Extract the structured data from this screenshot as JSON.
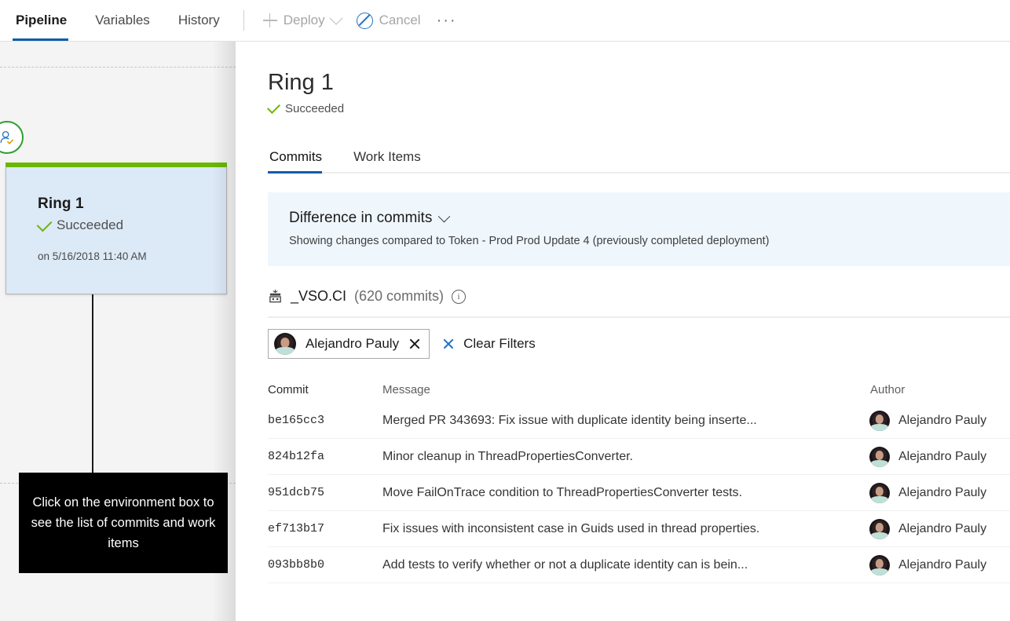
{
  "toolbar": {
    "tabs": [
      {
        "label": "Pipeline",
        "active": true
      },
      {
        "label": "Variables",
        "active": false
      },
      {
        "label": "History",
        "active": false
      }
    ],
    "deploy_label": "Deploy",
    "cancel_label": "Cancel",
    "more_label": "···",
    "deploy_icon": "plus-icon",
    "deploy_chevron_icon": "chevron-down-icon",
    "cancel_icon": "circle-slash-icon",
    "more_icon": "ellipsis-icon",
    "accent_color": "#0b5cab",
    "disabled_color": "#a6a6a6"
  },
  "pipeline": {
    "environment_card": {
      "name": "Ring 1",
      "status": "Succeeded",
      "timestamp": "on 5/16/2018 11:40 AM",
      "status_icon": "check-icon",
      "badge_icon": "approval-person-check-icon",
      "top_bar_color": "#6bb700",
      "background_color": "#dce9f7",
      "status_color": "#6bb700"
    },
    "callout": {
      "text": "Click on the environment box to see the list of commits and work items",
      "background_color": "#000000",
      "text_color": "#ffffff"
    }
  },
  "detail": {
    "title": "Ring 1",
    "status": "Succeeded",
    "status_icon": "check-icon",
    "tabs": [
      {
        "label": "Commits",
        "active": true
      },
      {
        "label": "Work Items",
        "active": false
      }
    ],
    "banner": {
      "heading": "Difference in commits",
      "chevron_icon": "chevron-down-icon",
      "subtext": "Showing changes compared to Token - Prod Prod Update 4 (previously completed deployment)",
      "background_color": "#eff6fc"
    },
    "repo": {
      "icon": "build-definition-icon",
      "name": "_VSO.CI",
      "count": "(620 commits)",
      "info_icon": "info-icon",
      "info_glyph": "i"
    },
    "filters": {
      "chip": {
        "label": "Alejandro Pauly",
        "avatar_icon": "avatar",
        "remove_icon": "close-icon"
      },
      "clear_label": "Clear Filters",
      "clear_icon": "close-icon"
    },
    "table": {
      "columns": [
        "Commit",
        "Message",
        "Author"
      ],
      "rows": [
        {
          "commit": "be165cc3",
          "message": "Merged PR 343693: Fix issue with duplicate identity being inserte...",
          "author": "Alejandro Pauly"
        },
        {
          "commit": "824b12fa",
          "message": "Minor cleanup in ThreadPropertiesConverter.",
          "author": "Alejandro Pauly"
        },
        {
          "commit": "951dcb75",
          "message": "Move FailOnTrace condition to ThreadPropertiesConverter tests.",
          "author": "Alejandro Pauly"
        },
        {
          "commit": "ef713b17",
          "message": "Fix issues with inconsistent case in Guids used in thread properties.",
          "author": "Alejandro Pauly"
        },
        {
          "commit": "093bb8b0",
          "message": "Add tests to verify whether or not a duplicate identity can is bein...",
          "author": "Alejandro Pauly"
        }
      ]
    }
  }
}
